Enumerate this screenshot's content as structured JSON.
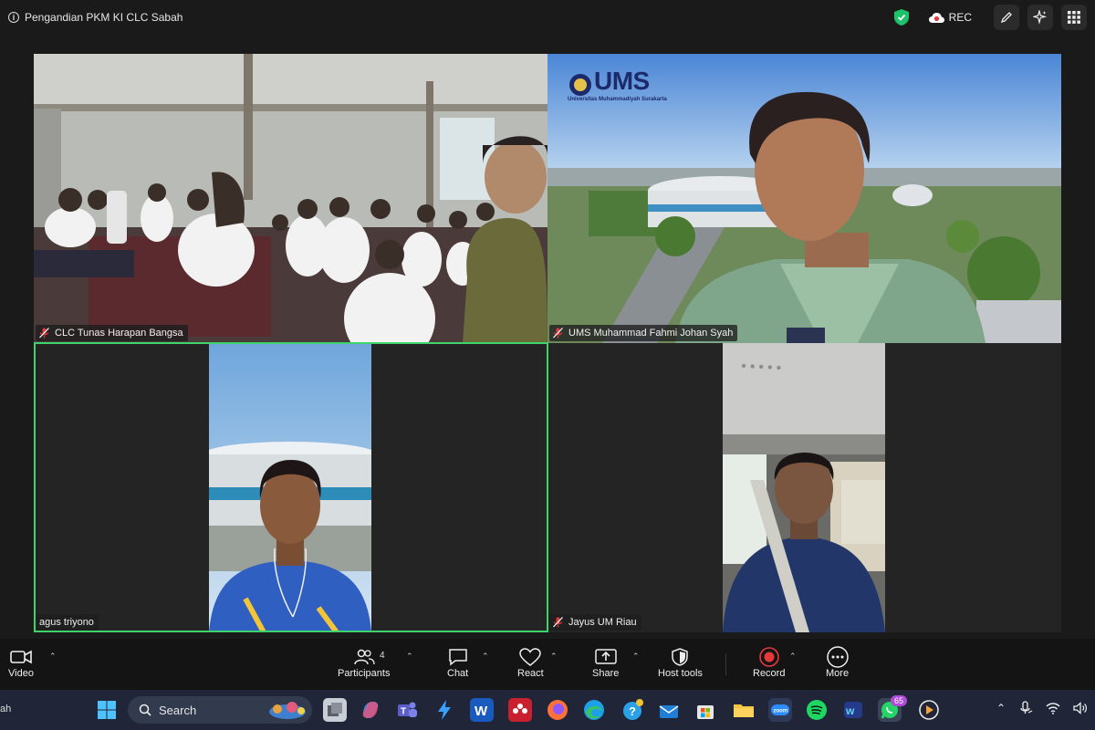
{
  "window": {
    "meeting_title": "Pengandian PKM KI CLC Sabah",
    "rec_label": "REC"
  },
  "participants": [
    {
      "name": "CLC Tunas Harapan Bangsa",
      "muted": true
    },
    {
      "name": "UMS Muhammad Fahmi Johan Syah",
      "muted": true,
      "background_logo": "UMS",
      "background_logo_sub": "Universitas Muhammadiyah Surakarta"
    },
    {
      "name": "agus triyono",
      "muted": false,
      "active_speaker": true
    },
    {
      "name": "Jayus UM Riau",
      "muted": true
    }
  ],
  "toolbar": {
    "video": "Video",
    "participants": "Participants",
    "participants_count": "4",
    "chat": "Chat",
    "react": "React",
    "share": "Share",
    "host_tools": "Host tools",
    "record": "Record",
    "more": "More"
  },
  "taskbar": {
    "left_clip": "ah",
    "search_label": "Search",
    "whatsapp_badge": "65"
  },
  "colors": {
    "active_speaker": "#3ed36b",
    "record_red": "#e5393b",
    "shield_green": "#1ec26b",
    "muted_red": "#e5393b"
  }
}
